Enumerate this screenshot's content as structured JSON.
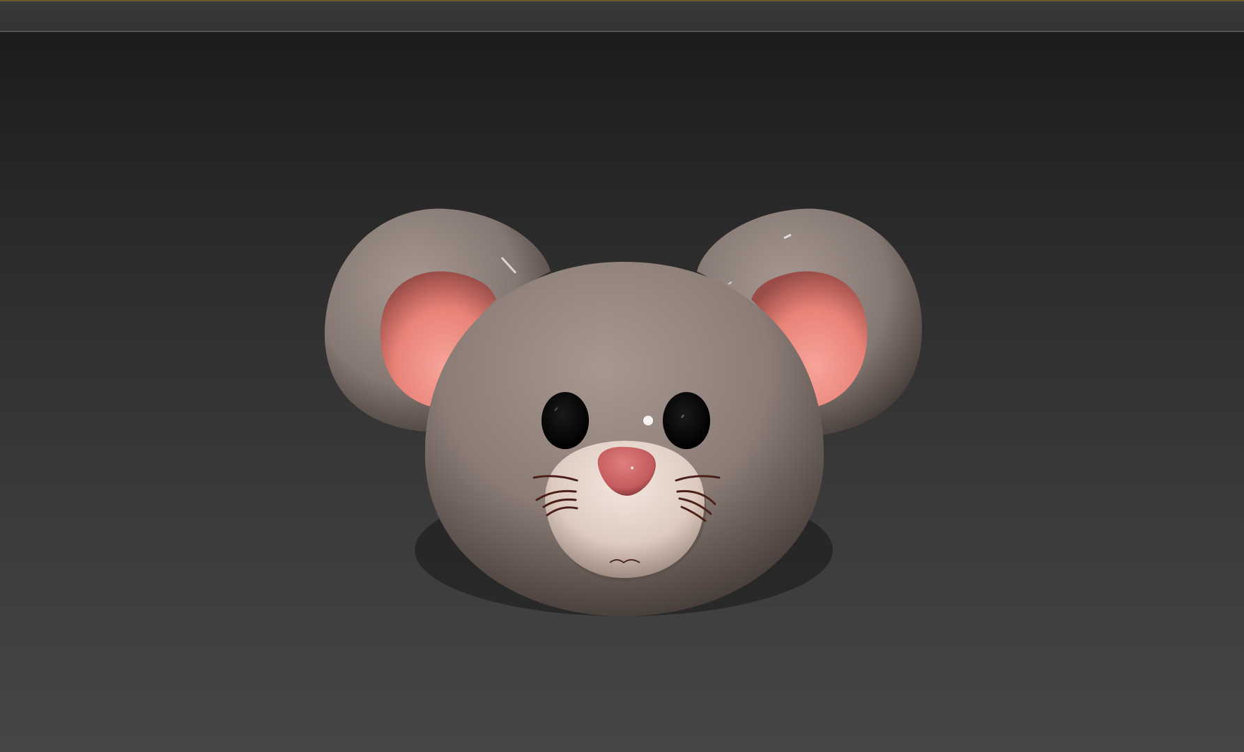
{
  "window": {
    "title": ""
  },
  "viewport": {
    "model_name": "mouse-head"
  },
  "colors": {
    "viewport_top": "#1c1c1c",
    "viewport_bottom": "#464646",
    "fur": "#9a8a83",
    "ear_inner": "#f08f86",
    "muzzle": "#e6d6cc",
    "nose": "#d06a6a",
    "eyes": "#050505",
    "whiskers": "#5a2a20"
  }
}
